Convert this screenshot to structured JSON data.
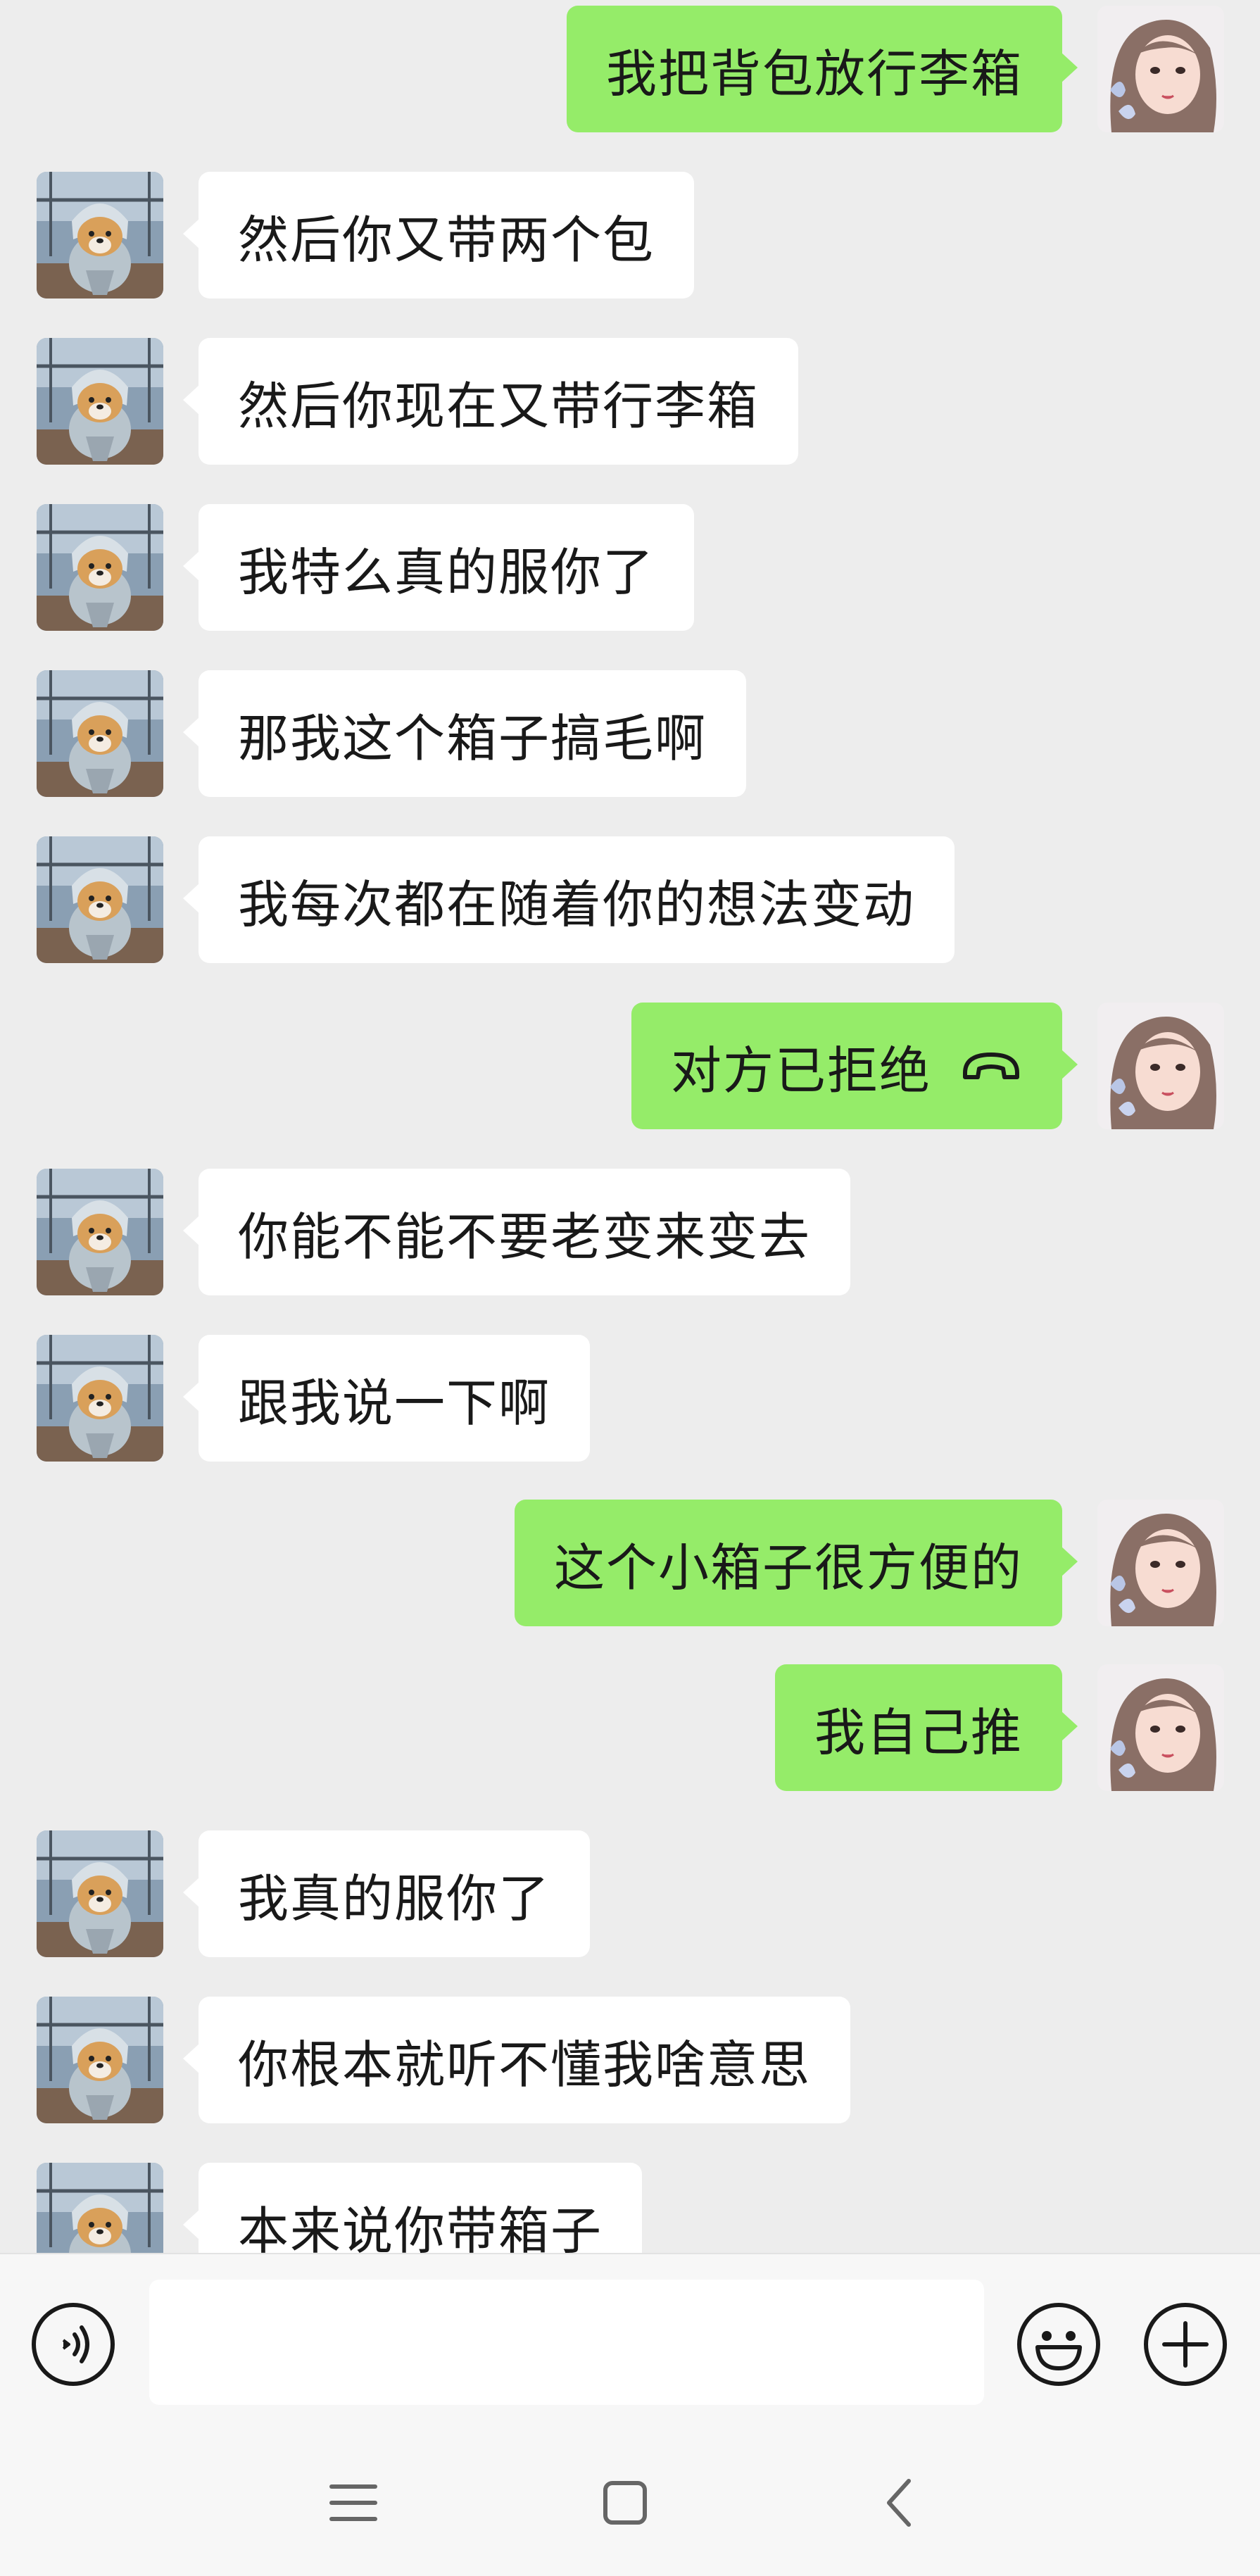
{
  "messages": [
    {
      "side": "right",
      "text": "我把背包放行李箱"
    },
    {
      "side": "left",
      "text": "然后你又带两个包"
    },
    {
      "side": "left",
      "text": "然后你现在又带行李箱"
    },
    {
      "side": "left",
      "text": "我特么真的服你了"
    },
    {
      "side": "left",
      "text": "那我这个箱子搞毛啊"
    },
    {
      "side": "left",
      "text": "我每次都在随着你的想法变动"
    },
    {
      "side": "right",
      "text": "对方已拒绝",
      "icon": "hang-up-phone-icon"
    },
    {
      "side": "left",
      "text": "你能不能不要老变来变去"
    },
    {
      "side": "left",
      "text": "跟我说一下啊"
    },
    {
      "side": "right",
      "text": "这个小箱子很方便的"
    },
    {
      "side": "right",
      "text": "我自己推"
    },
    {
      "side": "left",
      "text": "我真的服你了"
    },
    {
      "side": "left",
      "text": "你根本就听不懂我啥意思"
    },
    {
      "side": "left",
      "text": "本来说你带箱子"
    }
  ],
  "input_bar": {
    "text_value": "",
    "icons": [
      "voice-icon",
      "emoji-icon",
      "plus-icon"
    ]
  },
  "nav_bar": {
    "icons": [
      "menu-icon",
      "home-icon",
      "back-icon"
    ]
  },
  "colors": {
    "background": "#ededed",
    "sent_bubble": "#95ec69",
    "received_bubble": "#ffffff",
    "text": "#191919"
  }
}
